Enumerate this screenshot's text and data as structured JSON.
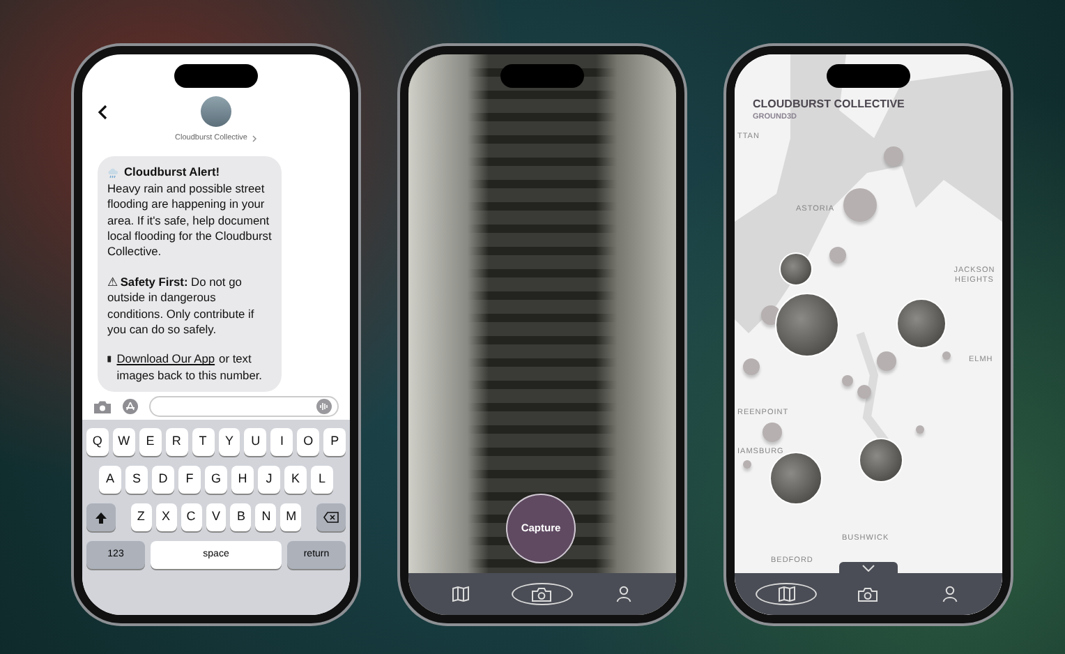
{
  "messages_screen": {
    "contact_name": "Cloudburst Collective",
    "message": {
      "title": "Cloudburst Alert!",
      "body": "Heavy rain and possible street flooding are happening in your area. If it's safe, help document local flooding for the Cloudburst Collective.",
      "safety": "⚠ **Safety First:** Do not go outside in dangerous conditions. Only contribute if you can do so safely.",
      "download_link": "Download Our App",
      "download_text": "or text images back to this number."
    },
    "keyboard": {
      "rows": [
        [
          "Q",
          "W",
          "E",
          "R",
          "T",
          "Y",
          "U",
          "I",
          "O",
          "P"
        ],
        [
          "A",
          "S",
          "D",
          "F",
          "G",
          "H",
          "J",
          "K",
          "L"
        ],
        [
          "Z",
          "X",
          "C",
          "V",
          "B",
          "N",
          "M"
        ]
      ],
      "bottom_keys": [
        "123",
        "space",
        "return"
      ]
    }
  },
  "camera_screen": {
    "capture_button": "Capture",
    "tab_bar": [
      {
        "kind": "map",
        "selected": false
      },
      {
        "kind": "camera",
        "selected": true
      },
      {
        "kind": "profile",
        "selected": false
      }
    ]
  },
  "map_screen": {
    "title": "CLOUDBURST COLLECTIVE",
    "subtitle": "GROUND3D",
    "map_labels": [
      "TTAN",
      "ASTORIA",
      "JACKSON HEIGHTS",
      "ELMH",
      "REENPOINT",
      "IAMSBURG",
      "BUSHWICK",
      "BEDFORD"
    ],
    "tab_bar": [
      {
        "kind": "map",
        "selected": true
      },
      {
        "kind": "camera",
        "selected": false
      },
      {
        "kind": "profile",
        "selected": false
      }
    ]
  }
}
